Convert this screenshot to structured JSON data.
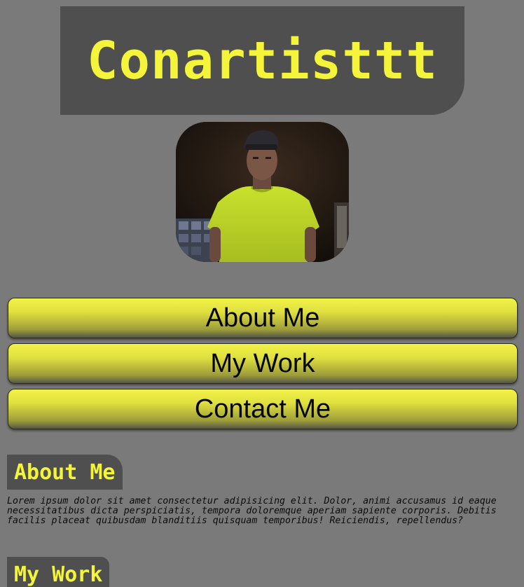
{
  "header": {
    "title": "Conartisttt"
  },
  "profile_image": {
    "icon": "profile-photo"
  },
  "nav": {
    "about_label": "About Me",
    "work_label": "My Work",
    "contact_label": "Contact Me"
  },
  "about": {
    "heading": "About Me",
    "body": "Lorem ipsum dolor sit amet consectetur adipisicing elit. Dolor, animi accusamus id eaque necessitatibus dicta perspiciatis, tempora doloremque aperiam sapiente corporis. Debitis facilis placeat quibusdam blanditiis quisquam temporibus! Reiciendis, repellendus?"
  },
  "work": {
    "heading": "My Work"
  },
  "colors": {
    "background": "#7a7a7a",
    "panel": "#4f4f4f",
    "accent_yellow": "#f4f43a",
    "button_text": "#050505"
  }
}
